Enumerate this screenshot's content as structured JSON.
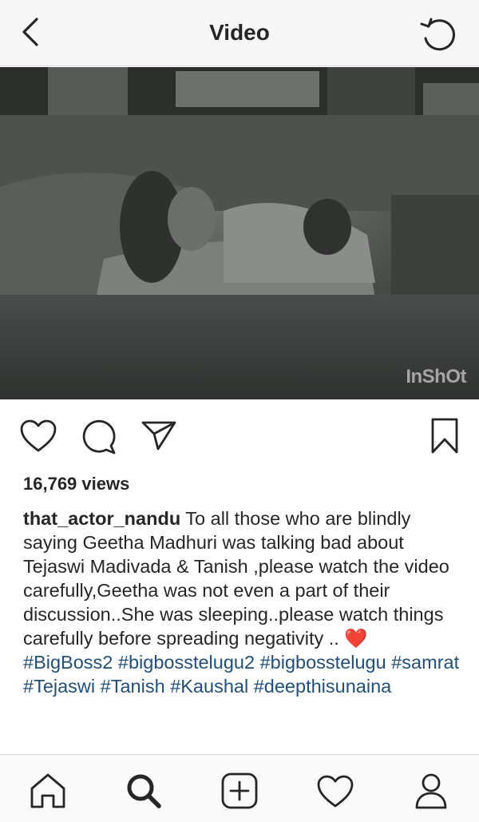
{
  "header": {
    "title": "Video",
    "back_icon": "chevron-left-icon",
    "refresh_icon": "refresh-icon"
  },
  "video": {
    "watermark": "InShOt"
  },
  "actions": {
    "like_icon": "heart-outline-icon",
    "comment_icon": "comment-bubble-icon",
    "share_icon": "paper-plane-icon",
    "save_icon": "bookmark-icon"
  },
  "post": {
    "views": "16,769 views",
    "username": "that_actor_nandu",
    "caption_text": " To all those who are blindly saying Geetha Madhuri  was talking bad about Tejaswi Madivada & Tanish ,please watch the video carefully,Geetha was not even a part of their discussion..She was sleeping..please watch things carefully before spreading negativity .. ",
    "emoji": "❤️",
    "hashtags": [
      "#BigBoss2",
      "#bigbosstelugu2",
      "#bigbosstelugu",
      "#samrat",
      "#Tejaswi",
      "#Tanish",
      "#Kaushal",
      "#deepthisunaina"
    ]
  },
  "bottom_nav": {
    "items": [
      {
        "name": "home",
        "icon": "home-icon"
      },
      {
        "name": "search",
        "icon": "search-icon"
      },
      {
        "name": "new-post",
        "icon": "plus-square-icon"
      },
      {
        "name": "activity",
        "icon": "heart-icon"
      },
      {
        "name": "profile",
        "icon": "profile-icon"
      }
    ]
  },
  "colors": {
    "hashtag": "#1f4f7d",
    "text": "#262626",
    "header_bg": "#f7f7f7",
    "heart": "#e1002a"
  }
}
